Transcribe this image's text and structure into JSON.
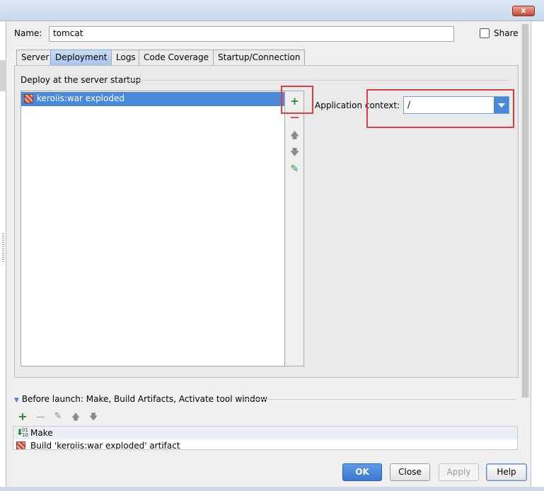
{
  "window": {
    "close_glyph": "x"
  },
  "name_row": {
    "label": "Name:",
    "value": "tomcat",
    "share_label": "Share",
    "share_checked": false
  },
  "tabs": [
    {
      "label": "Server",
      "active": false
    },
    {
      "label": "Deployment",
      "active": true
    },
    {
      "label": "Logs",
      "active": false
    },
    {
      "label": "Code Coverage",
      "active": false
    },
    {
      "label": "Startup/Connection",
      "active": false
    }
  ],
  "deploy": {
    "section_label": "Deploy at the server startup",
    "items": [
      {
        "label": "keroiis:war exploded",
        "selected": true,
        "icon": "artifact-icon"
      }
    ],
    "toolbar": [
      {
        "name": "add-icon",
        "glyph": "+",
        "color": "#1a8f2a"
      },
      {
        "name": "remove-icon",
        "glyph": "—",
        "color": "#d33a3a"
      },
      {
        "name": "move-up-icon",
        "glyph": "🡅",
        "color": "#8a8a8a"
      },
      {
        "name": "move-down-icon",
        "glyph": "🡇",
        "color": "#8a8a8a"
      },
      {
        "name": "edit-icon",
        "glyph": "✎",
        "color": "#2d9c3c"
      }
    ]
  },
  "app_context": {
    "label": "Application context:",
    "value": "/"
  },
  "before_launch": {
    "label": "Before launch: Make, Build Artifacts, Activate tool window",
    "toolbar": [
      {
        "name": "add-icon",
        "glyph": "+",
        "color": "#1a8f2a"
      },
      {
        "name": "remove-icon",
        "glyph": "—",
        "color": "#8a8a8a"
      },
      {
        "name": "edit-icon",
        "glyph": "✎",
        "color": "#8a8a8a"
      },
      {
        "name": "move-up-icon",
        "glyph": "🡅",
        "color": "#8a8a8a"
      },
      {
        "name": "move-down-icon",
        "glyph": "🡇",
        "color": "#8a8a8a"
      }
    ],
    "items": [
      {
        "label": "Make",
        "icon": "make-icon"
      },
      {
        "label": "Build 'keroiis:war exploded' artifact",
        "icon": "artifact-icon"
      }
    ]
  },
  "buttons": {
    "ok": "OK",
    "close": "Close",
    "apply": "Apply",
    "help": "Help"
  },
  "colors": {
    "accent": "#4a88d8",
    "highlight_box": "#e23c3c"
  }
}
